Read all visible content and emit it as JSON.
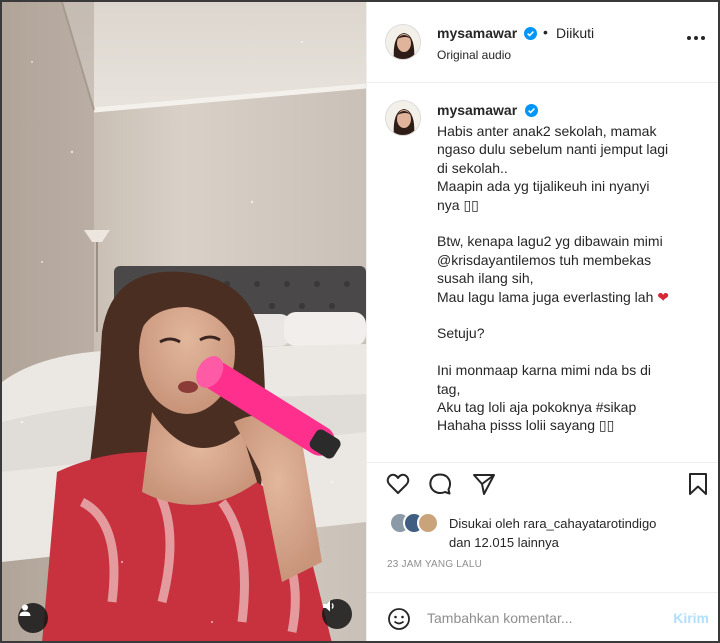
{
  "post": {
    "username": "mysamawar",
    "follow_label": "Diikuti",
    "separator": "•",
    "audio": "Original audio"
  },
  "caption": {
    "username": "mysamawar",
    "paragraphs": [
      [
        "Habis anter anak2 sekolah, mamak",
        "ngaso dulu sebelum nanti jemput lagi",
        "di sekolah..",
        "Maapin ada yg tijalikeuh ini nyanyi",
        "nya ▯▯"
      ],
      [
        "Btw, kenapa lagu2 yg dibawain mimi",
        "@krisdayantilemos tuh membekas",
        "susah ilang sih,",
        "Mau lagu lama juga everlasting lah"
      ],
      [
        "Setuju?"
      ],
      [
        "Ini monmaap karna mimi nda bs di",
        "tag,",
        "Aku tag loli aja pokoknya #sikap",
        "Hahaha pisss lolii sayang ▯▯"
      ]
    ],
    "heart": "❤"
  },
  "likes": {
    "line1": "Disukai oleh rara_cahayatarotindigo",
    "line2": "dan 12.015 lainnya"
  },
  "timestamp": "23 JAM YANG LALU",
  "comment": {
    "placeholder": "Tambahkan komentar...",
    "post_label": "Kirim"
  },
  "icons": {
    "like": "heart-icon",
    "comment": "comment-icon",
    "share": "share-icon",
    "save": "bookmark-icon",
    "more": "more-options-icon",
    "emoji": "emoji-icon",
    "mute": "speaker-icon",
    "tags": "user-tag-icon",
    "verified": "verified-badge-icon"
  },
  "colors": {
    "verified": "#0095f6",
    "post_button": "#b2dffc",
    "microphone": "#ff2f8e",
    "dress": "#c8323f"
  }
}
